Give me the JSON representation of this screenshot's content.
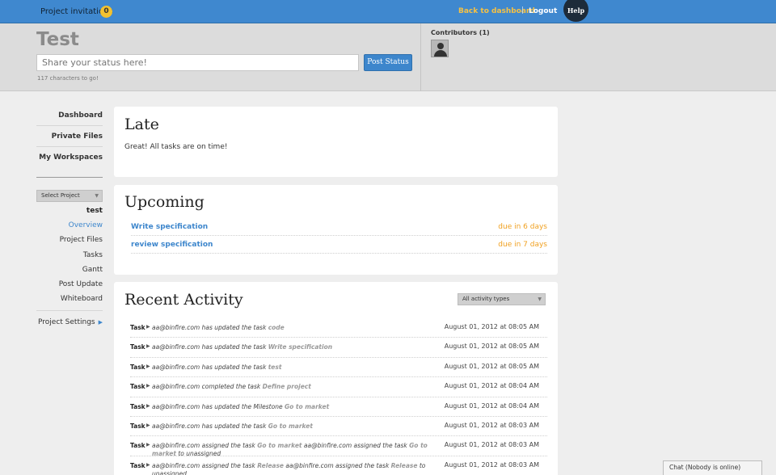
{
  "topbar": {
    "invitations_label": "Project invitations",
    "invitations_count": "0",
    "back_label": "Back to dashboard",
    "separator": "|",
    "logout_label": "Logout",
    "help_label": "Help"
  },
  "header": {
    "title": "Test",
    "status_placeholder": "Share your status here!",
    "post_button": "Post Status",
    "char_count": "117 characters to go!",
    "contributors": "Contributors (1)"
  },
  "sidebar": {
    "main": [
      "Dashboard",
      "Private Files",
      "My Workspaces"
    ],
    "select_project": "Select Project",
    "project_name": "test",
    "sub": [
      "Overview",
      "Project Files",
      "Tasks",
      "Gantt",
      "Post Update",
      "Whiteboard"
    ],
    "settings": "Project Settings"
  },
  "late": {
    "title": "Late",
    "message": "Great! All tasks are on time!"
  },
  "upcoming": {
    "title": "Upcoming",
    "items": [
      {
        "task": "Write specification",
        "due": "due in 6 days"
      },
      {
        "task": "review specification",
        "due": "due in 7 days"
      }
    ]
  },
  "recent": {
    "title": "Recent Activity",
    "filter": "All activity types",
    "items": [
      {
        "kind": "Task",
        "pre": "aa@binfire.com has updated the task ",
        "obj": "code",
        "post": "",
        "obj2": "",
        "post2": "",
        "date": "August 01, 2012 at 08:05 AM"
      },
      {
        "kind": "Task",
        "pre": "aa@binfire.com has updated the task ",
        "obj": "Write specification",
        "post": "",
        "obj2": "",
        "post2": "",
        "date": "August 01, 2012 at 08:05 AM"
      },
      {
        "kind": "Task",
        "pre": "aa@binfire.com has updated the task ",
        "obj": "test",
        "post": "",
        "obj2": "",
        "post2": "",
        "date": "August 01, 2012 at 08:05 AM"
      },
      {
        "kind": "Task",
        "pre": "aa@binfire.com completed the task ",
        "obj": "Define project",
        "post": "",
        "obj2": "",
        "post2": "",
        "date": "August 01, 2012 at 08:04 AM"
      },
      {
        "kind": "Task",
        "pre": "aa@binfire.com has updated the Milestone ",
        "obj": "Go to market",
        "post": "",
        "obj2": "",
        "post2": "",
        "date": "August 01, 2012 at 08:04 AM"
      },
      {
        "kind": "Task",
        "pre": "aa@binfire.com has updated the task ",
        "obj": "Go to market",
        "post": "",
        "obj2": "",
        "post2": "",
        "date": "August 01, 2012 at 08:03 AM"
      },
      {
        "kind": "Task",
        "pre": "aa@binfire.com assigned the task ",
        "obj": "Go to market",
        "post": " aa@binfire.com assigned the task ",
        "obj2": "Go to market",
        "post2": " to unassigned",
        "date": "August 01, 2012 at 08:03 AM"
      },
      {
        "kind": "Task",
        "pre": "aa@binfire.com assigned the task ",
        "obj": "Release",
        "post": " aa@binfire.com assigned the task ",
        "obj2": "Release",
        "post2": " to unassigned",
        "date": "August 01, 2012 at 08:03 AM"
      }
    ]
  },
  "chat": {
    "label": "Chat (Nobody is online)"
  }
}
